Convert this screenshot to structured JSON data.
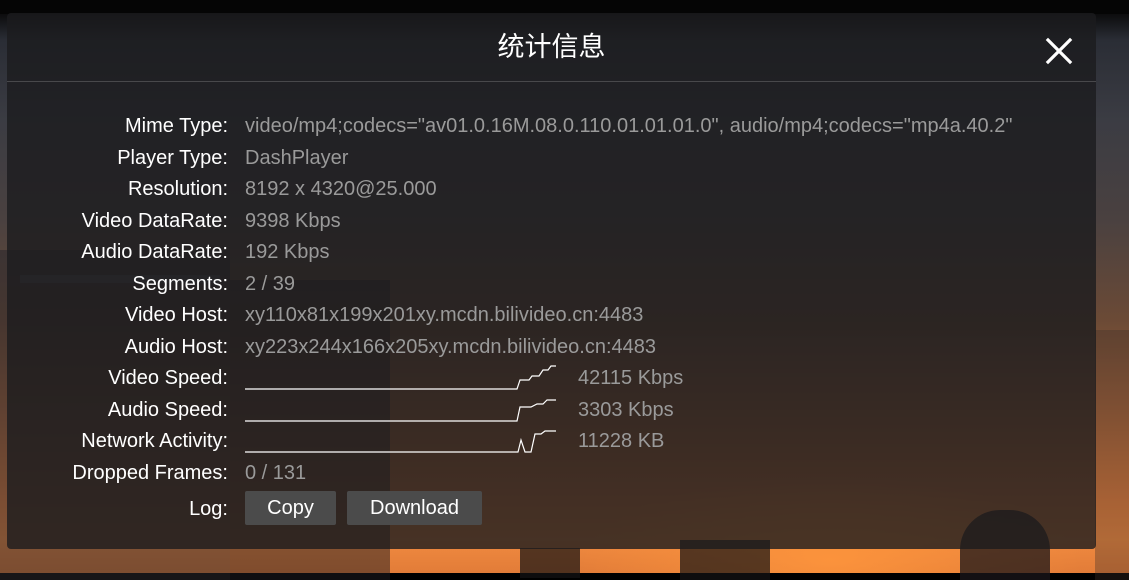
{
  "dialog": {
    "title": "统计信息",
    "close_icon": "close-icon"
  },
  "stats": {
    "mime_type": {
      "label": "Mime Type:",
      "value": "video/mp4;codecs=\"av01.0.16M.08.0.110.01.01.01.0\", audio/mp4;codecs=\"mp4a.40.2\""
    },
    "player_type": {
      "label": "Player Type:",
      "value": "DashPlayer"
    },
    "resolution": {
      "label": "Resolution:",
      "value": "8192 x 4320@25.000"
    },
    "video_datarate": {
      "label": "Video DataRate:",
      "value": "9398 Kbps"
    },
    "audio_datarate": {
      "label": "Audio DataRate:",
      "value": "192 Kbps"
    },
    "segments": {
      "label": "Segments:",
      "value": "2 / 39"
    },
    "video_host": {
      "label": "Video Host:",
      "value": "xy110x81x199x201xy.mcdn.bilivideo.cn:4483"
    },
    "audio_host": {
      "label": "Audio Host:",
      "value": "xy223x244x166x205xy.mcdn.bilivideo.cn:4483"
    },
    "video_speed": {
      "label": "Video Speed:",
      "value": "42115 Kbps"
    },
    "audio_speed": {
      "label": "Audio Speed:",
      "value": "3303 Kbps"
    },
    "network_activity": {
      "label": "Network Activity:",
      "value": "11228 KB"
    },
    "dropped_frames": {
      "label": "Dropped Frames:",
      "value": "0 / 131"
    },
    "log": {
      "label": "Log:",
      "copy_label": "Copy",
      "download_label": "Download"
    }
  },
  "colors": {
    "panel_bg": "#1c1c1e",
    "label_text": "#ffffff",
    "value_text": "#9a9a9a",
    "button_bg": "#4b4b4b",
    "sparkline": "#ffffff"
  }
}
